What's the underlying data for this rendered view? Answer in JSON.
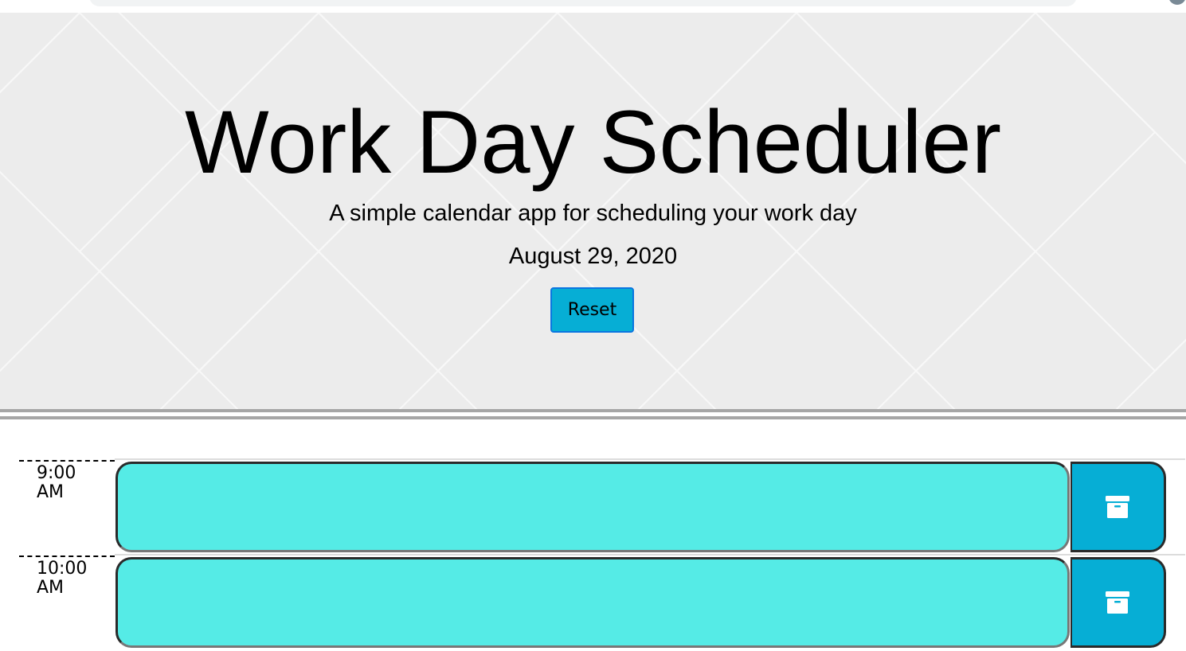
{
  "header": {
    "title": "Work Day Scheduler",
    "subtitle": "A simple calendar app for scheduling your work day",
    "date": "August 29, 2020",
    "reset_label": "Reset"
  },
  "rows": [
    {
      "hour_line1": "9:00",
      "hour_line2": "AM",
      "description": "",
      "save_icon": "archive-icon"
    },
    {
      "hour_line1": "10:00",
      "hour_line2": "AM",
      "description": "",
      "save_icon": "archive-icon"
    }
  ],
  "colors": {
    "present": "#55ebe6",
    "button": "#06aed5",
    "header_bg": "#ececec",
    "divider": "#a6a6a6"
  }
}
